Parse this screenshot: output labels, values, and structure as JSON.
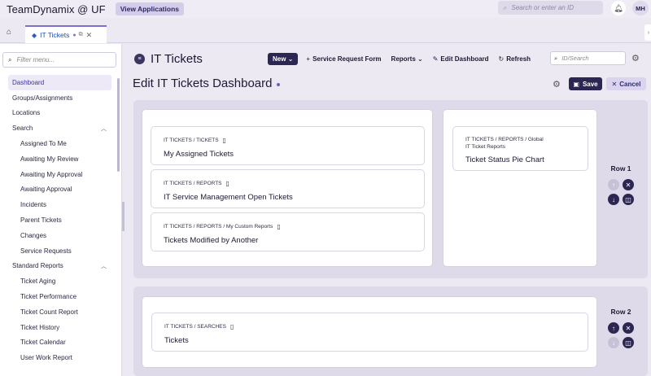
{
  "topbar": {
    "brand": "TeamDynamix @ UF",
    "view_apps": "View Applications",
    "search_placeholder": "Search or enter an ID",
    "user_initials": "MH"
  },
  "tabs": [
    {
      "label": "IT Tickets",
      "active": true
    }
  ],
  "sidebar": {
    "filter_placeholder": "Filter menu...",
    "items": [
      {
        "label": "Dashboard",
        "active": true
      },
      {
        "label": "Groups/Assignments"
      },
      {
        "label": "Locations"
      },
      {
        "label": "Search",
        "group": true
      },
      {
        "label": "Assigned To Me",
        "sub": true
      },
      {
        "label": "Awaiting My Review",
        "sub": true
      },
      {
        "label": "Awaiting My Approval",
        "sub": true
      },
      {
        "label": "Awaiting Approval",
        "sub": true
      },
      {
        "label": "Incidents",
        "sub": true
      },
      {
        "label": "Parent Tickets",
        "sub": true
      },
      {
        "label": "Changes",
        "sub": true
      },
      {
        "label": "Service Requests",
        "sub": true
      },
      {
        "label": "Standard Reports",
        "group": true
      },
      {
        "label": "Ticket Aging",
        "sub": true
      },
      {
        "label": "Ticket Performance",
        "sub": true
      },
      {
        "label": "Ticket Count Report",
        "sub": true
      },
      {
        "label": "Ticket History",
        "sub": true
      },
      {
        "label": "Ticket Calendar",
        "sub": true
      },
      {
        "label": "User Work Report",
        "sub": true
      }
    ]
  },
  "header": {
    "app_title": "IT Tickets",
    "new_label": "New",
    "service_request_form": "Service Request Form",
    "reports_label": "Reports",
    "edit_dashboard": "Edit Dashboard",
    "refresh": "Refresh",
    "id_search_placeholder": "ID/Search"
  },
  "page": {
    "title": "Edit IT Tickets Dashboard",
    "save": "Save",
    "cancel": "Cancel"
  },
  "rows": [
    {
      "label": "Row 1",
      "left_widgets": [
        {
          "crumb": "IT TICKETS / TICKETS",
          "title": "My Assigned Tickets"
        },
        {
          "crumb": "IT TICKETS / REPORTS",
          "title": "IT Service Management Open Tickets"
        },
        {
          "crumb": "IT TICKETS / REPORTS / My Custom Reports",
          "title": "Tickets Modified by Another"
        }
      ],
      "right_widgets": [
        {
          "crumb_line1": "IT TICKETS / REPORTS / Global",
          "crumb_line2": "IT Ticket Reports",
          "title": "Ticket Status Pie Chart"
        }
      ]
    },
    {
      "label": "Row 2",
      "widgets": [
        {
          "crumb": "IT TICKETS / SEARCHES",
          "title": "Tickets"
        }
      ]
    }
  ],
  "icons": {
    "home": "home-icon",
    "tag": "tag-icon",
    "search": "search-icon",
    "bell": "bell-icon",
    "gear": "gear-icon",
    "save": "floppy-icon",
    "phone": "mobile-icon"
  }
}
